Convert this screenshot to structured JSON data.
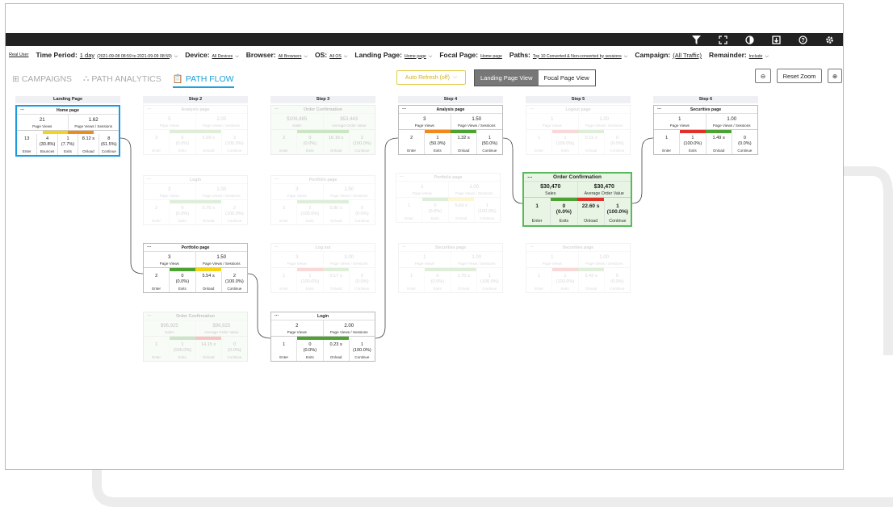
{
  "topbar": {
    "icons": [
      "filter-icon",
      "fullscreen-icon",
      "contrast-icon",
      "export-icon",
      "help-icon",
      "settings-icon"
    ]
  },
  "filters": {
    "user_type": "Real User",
    "time_period": {
      "label": "Time Period:",
      "value": "1 day",
      "range": "(2021-09-08 08:59 to 2021-09-09 08:59)"
    },
    "device": {
      "label": "Device:",
      "value": "All Devices"
    },
    "browser": {
      "label": "Browser:",
      "value": "All Browsers"
    },
    "os": {
      "label": "OS:",
      "value": "All OS"
    },
    "landing": {
      "label": "Landing Page:",
      "value": "Home page"
    },
    "focal": {
      "label": "Focal Page:",
      "value": "Home page"
    },
    "paths": {
      "label": "Paths:",
      "value": "Top 10 Converted & Non-converted by sessions"
    },
    "campaign": {
      "label": "Campaign:",
      "value": "(All Traffic)"
    },
    "remainder": {
      "label": "Remainder:",
      "value": "Include"
    }
  },
  "nav": {
    "campaigns": "CAMPAIGNS",
    "path_analytics": "PATH ANALYTICS",
    "path_flow": "PATH FLOW"
  },
  "toolbar": {
    "auto_refresh": "Auto Refresh (off)",
    "landing_view": "Landing Page View",
    "focal_view": "Focal Page View",
    "reset_zoom": "Reset Zoom"
  },
  "steps": [
    "Landing Page",
    "Step 2",
    "Step 3",
    "Step 4",
    "Step 5",
    "Step 6"
  ],
  "colors": {
    "green": "#4ca334",
    "red": "#e0322b",
    "orange": "#f08a1c",
    "yellow": "#f5d316",
    "blue": "#1a9be0"
  },
  "cards": [
    {
      "id": "c1",
      "title": "Home page",
      "s1v": "21",
      "s1l": "Page Views",
      "s2v": "1.62",
      "s2l": "Page Views / Sessions",
      "bar": [
        "yellow",
        "orange"
      ],
      "m": [
        [
          "13",
          "Enter"
        ],
        [
          "4\n(30.8%)",
          "Bounces"
        ],
        [
          "1\n(7.7%)",
          "Exits"
        ],
        [
          "8.12 s",
          "Onload"
        ],
        [
          "8\n(61.5%)",
          "Continue"
        ]
      ]
    },
    {
      "id": "c2",
      "title": "Analysis page",
      "s1v": "5",
      "s1l": "Page Views",
      "s2v": "2.00",
      "s2l": "Page Views / Sessions",
      "bar": [
        "green",
        "green"
      ],
      "m": [
        [
          "3",
          "Enter"
        ],
        [
          "0\n(0.0%)",
          "Exits"
        ],
        [
          "2.09 s",
          "Onload"
        ],
        [
          "3\n(100.0%)",
          "Continue"
        ]
      ]
    },
    {
      "id": "c3",
      "title": "Login",
      "s1v": "3",
      "s1l": "Page Views",
      "s2v": "1.00",
      "s2l": "Page Views / Sessions",
      "bar": [
        "green",
        "green"
      ],
      "m": [
        [
          "2",
          "Enter"
        ],
        [
          "0\n(0.0%)",
          "Exits"
        ],
        [
          "0.75 s",
          "Onload"
        ],
        [
          "2\n(100.0%)",
          "Continue"
        ]
      ]
    },
    {
      "id": "c4",
      "title": "Portfolio page",
      "s1v": "3",
      "s1l": "Page Views",
      "s2v": "1.50",
      "s2l": "Page Views / Sessions",
      "bar": [
        "green",
        "yellow"
      ],
      "m": [
        [
          "2",
          "Enter"
        ],
        [
          "0\n(0.0%)",
          "Exits"
        ],
        [
          "5.54 s",
          "Onload"
        ],
        [
          "2\n(100.0%)",
          "Continue"
        ]
      ]
    },
    {
      "id": "c5",
      "title": "Order Confirmation",
      "s1v": "$96,925",
      "s1l": "Sales",
      "s2v": "$96,925",
      "s2l": "Average Order Value",
      "bar": [
        "green",
        "red"
      ],
      "m": [
        [
          "1",
          "Enter"
        ],
        [
          "1\n(100.0%)",
          "Exits"
        ],
        [
          "14.15 s",
          "Onload"
        ],
        [
          "0\n(0.0%)",
          "Continue"
        ]
      ]
    },
    {
      "id": "c6",
      "title": "Order Confirmation",
      "s1v": "$106,885",
      "s1l": "Sales",
      "s2v": "$53,443",
      "s2l": "Average Order Value",
      "bar": [
        "green",
        "green"
      ],
      "m": [
        [
          "2",
          "Enter"
        ],
        [
          "0\n(0.0%)",
          "Exits"
        ],
        [
          "16.16 s",
          "Onload"
        ],
        [
          "2\n(100.0%)",
          "Continue"
        ]
      ]
    },
    {
      "id": "c7",
      "title": "Portfolio page",
      "s1v": "3",
      "s1l": "Page Views",
      "s2v": "1.50",
      "s2l": "Page Views / Sessions",
      "bar": [
        "green",
        "green"
      ],
      "m": [
        [
          "2",
          "Enter"
        ],
        [
          "2\n(100.0%)",
          "Exits"
        ],
        [
          "5.80 s",
          "Onload"
        ],
        [
          "0\n(0.0%)",
          "Continue"
        ]
      ]
    },
    {
      "id": "c8",
      "title": "Log out",
      "s1v": "3",
      "s1l": "Page Views",
      "s2v": "3.00",
      "s2l": "Page Views / Sessions",
      "bar": [
        "red",
        "green"
      ],
      "m": [
        [
          "1",
          "Enter"
        ],
        [
          "1\n(100.0%)",
          "Exits"
        ],
        [
          "0.17 s",
          "Onload"
        ],
        [
          "0\n(0.0%)",
          "Continue"
        ]
      ]
    },
    {
      "id": "c9",
      "title": "Login",
      "s1v": "2",
      "s1l": "Page Views",
      "s2v": "2.00",
      "s2l": "Page Views / Sessions",
      "bar": [
        "green",
        "green"
      ],
      "m": [
        [
          "1",
          "Enter"
        ],
        [
          "0\n(0.0%)",
          "Exits"
        ],
        [
          "0.23 s",
          "Onload"
        ],
        [
          "1\n(100.0%)",
          "Continue"
        ]
      ]
    },
    {
      "id": "c10",
      "title": "Analysis page",
      "s1v": "3",
      "s1l": "Page Views",
      "s2v": "1.50",
      "s2l": "Page Views / Sessions",
      "bar": [
        "orange",
        "green"
      ],
      "m": [
        [
          "2",
          "Enter"
        ],
        [
          "1\n(50.0%)",
          "Exits"
        ],
        [
          "1.32 s",
          "Onload"
        ],
        [
          "1\n(50.0%)",
          "Continue"
        ]
      ]
    },
    {
      "id": "c11",
      "title": "Portfolio page",
      "s1v": "1",
      "s1l": "Page Views",
      "s2v": "1.00",
      "s2l": "Page Views / Sessions",
      "bar": [
        "green",
        "yellow"
      ],
      "m": [
        [
          "1",
          "Enter"
        ],
        [
          "0\n(0.0%)",
          "Exits"
        ],
        [
          "5.69 s",
          "Onload"
        ],
        [
          "1\n(100.0%)",
          "Continue"
        ]
      ]
    },
    {
      "id": "c12",
      "title": "Securities page",
      "s1v": "1",
      "s1l": "Page Views",
      "s2v": "1.00",
      "s2l": "Page Views / Sessions",
      "bar": [
        "green",
        "green"
      ],
      "m": [
        [
          "1",
          "Enter"
        ],
        [
          "0\n(0.0%)",
          "Exits"
        ],
        [
          "1.70 s",
          "Onload"
        ],
        [
          "1\n(100.0%)",
          "Continue"
        ]
      ]
    },
    {
      "id": "c13",
      "title": "Logout page",
      "s1v": "1",
      "s1l": "Page Views",
      "s2v": "1.00",
      "s2l": "Page Views / Sessions",
      "bar": [
        "red",
        "green"
      ],
      "m": [
        [
          "1",
          "Enter"
        ],
        [
          "1\n(100.0%)",
          "Exits"
        ],
        [
          "0.15 s",
          "Onload"
        ],
        [
          "0\n(0.0%)",
          "Continue"
        ]
      ]
    },
    {
      "id": "c14",
      "title": "Order Confirmation",
      "s1v": "$30,470",
      "s1l": "Sales",
      "s2v": "$30,470",
      "s2l": "Average Order Value",
      "bar": [
        "green",
        "red"
      ],
      "m": [
        [
          "1",
          "Enter"
        ],
        [
          "0\n(0.0%)",
          "Exits"
        ],
        [
          "22.60 s",
          "Onload"
        ],
        [
          "1\n(100.0%)",
          "Continue"
        ]
      ]
    },
    {
      "id": "c15",
      "title": "Securities page",
      "s1v": "1",
      "s1l": "Page Views",
      "s2v": "1.00",
      "s2l": "Page Views / Sessions",
      "bar": [
        "red",
        "green"
      ],
      "m": [
        [
          "1",
          "Enter"
        ],
        [
          "1\n(100.0%)",
          "Exits"
        ],
        [
          "2.42 s",
          "Onload"
        ],
        [
          "0\n(0.0%)",
          "Continue"
        ]
      ]
    },
    {
      "id": "c16",
      "title": "Securities page",
      "s1v": "1",
      "s1l": "Page Views",
      "s2v": "1.00",
      "s2l": "Page Views / Sessions",
      "bar": [
        "red",
        "green"
      ],
      "m": [
        [
          "1",
          "Enter"
        ],
        [
          "1\n(100.0%)",
          "Exits"
        ],
        [
          "1.49 s",
          "Onload"
        ],
        [
          "0\n(0.0%)",
          "Continue"
        ]
      ]
    }
  ]
}
